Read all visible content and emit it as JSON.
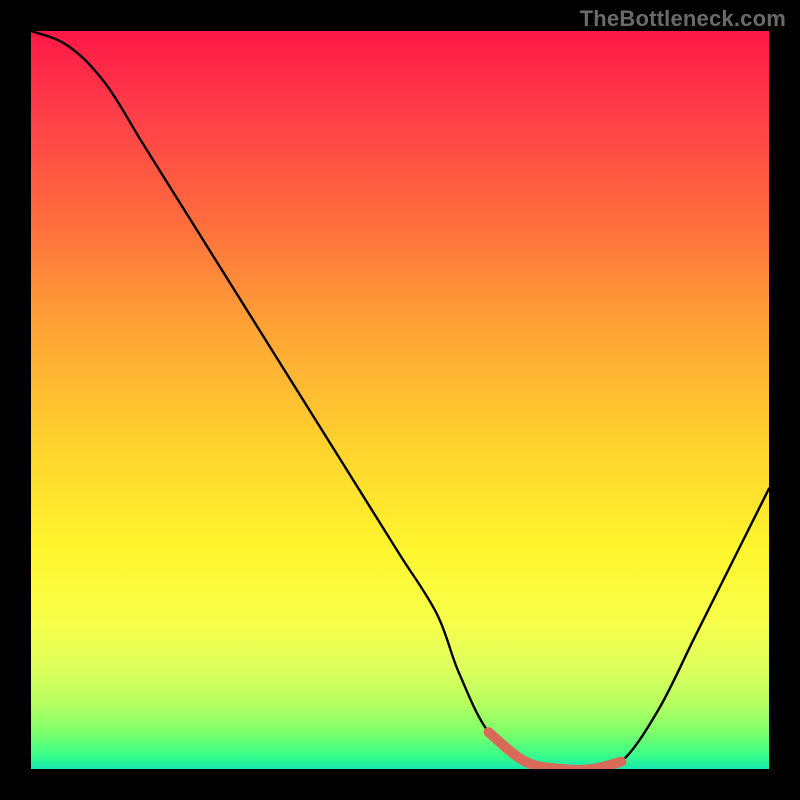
{
  "watermark": "TheBottleneck.com",
  "colors": {
    "background": "#000000",
    "watermark_text": "#6a6a6a",
    "curve_stroke": "#000000",
    "highlight_stroke": "#d96a5a"
  },
  "chart_data": {
    "type": "line",
    "title": "",
    "xlabel": "",
    "ylabel": "",
    "xlim": [
      0,
      100
    ],
    "ylim": [
      0,
      100
    ],
    "x": [
      0,
      5,
      10,
      15,
      20,
      25,
      30,
      35,
      40,
      45,
      50,
      55,
      58,
      62,
      67,
      72,
      76,
      80,
      85,
      90,
      95,
      100
    ],
    "values": [
      100,
      98,
      93,
      85,
      77,
      69,
      61,
      53,
      45,
      37,
      29,
      21,
      13,
      5,
      1,
      0,
      0,
      1,
      8,
      18,
      28,
      38
    ],
    "highlight_range_x": [
      62,
      80
    ],
    "highlight_values": [
      5,
      1,
      0,
      0,
      1
    ],
    "gradient_stops": [
      {
        "pos": 0,
        "color": "#ff1846"
      },
      {
        "pos": 10,
        "color": "#ff3a4a"
      },
      {
        "pos": 25,
        "color": "#ff6a3e"
      },
      {
        "pos": 40,
        "color": "#ffa236"
      },
      {
        "pos": 55,
        "color": "#ffcf2e"
      },
      {
        "pos": 70,
        "color": "#fff52e"
      },
      {
        "pos": 80,
        "color": "#f7ff4a"
      },
      {
        "pos": 86,
        "color": "#e0ff5c"
      },
      {
        "pos": 91,
        "color": "#b8ff60"
      },
      {
        "pos": 95,
        "color": "#7dff6a"
      },
      {
        "pos": 98,
        "color": "#3cff88"
      },
      {
        "pos": 100,
        "color": "#18e8b0"
      }
    ]
  }
}
